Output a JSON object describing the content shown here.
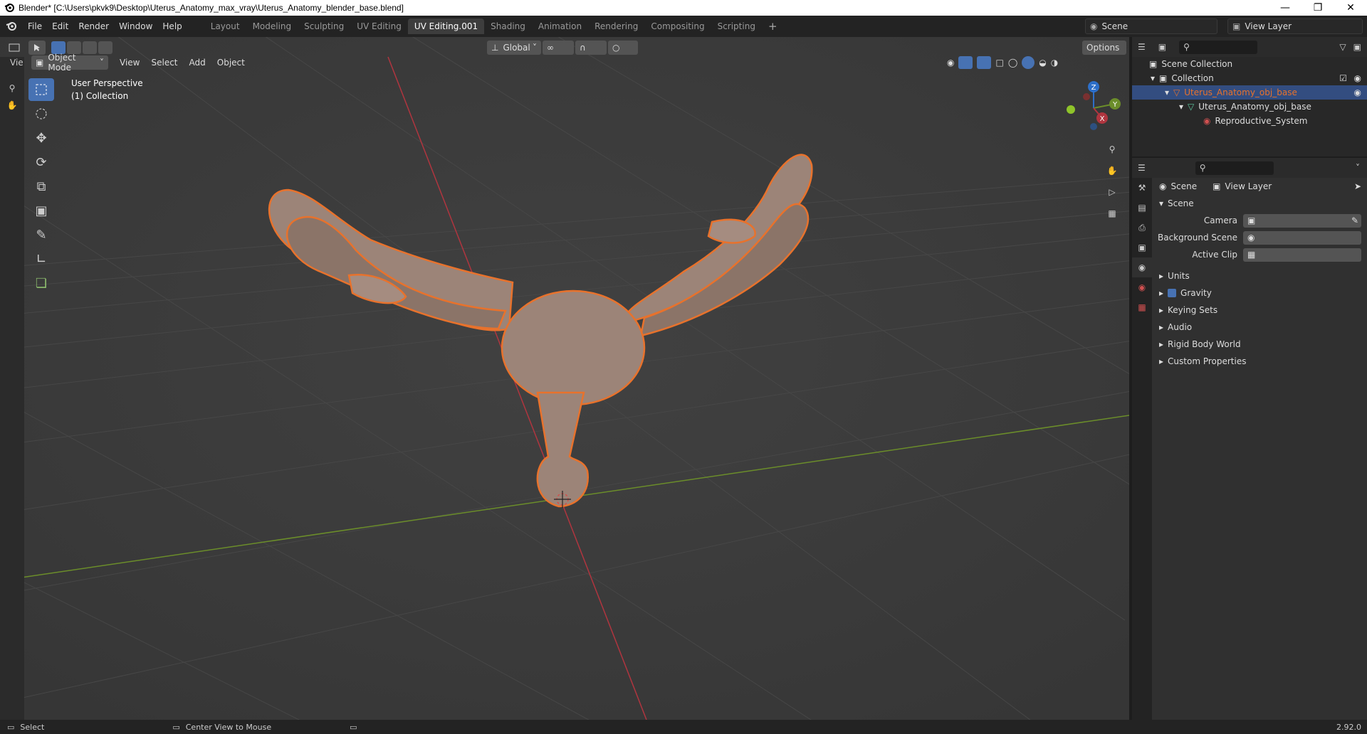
{
  "window": {
    "title": "Blender* [C:\\Users\\pkvk9\\Desktop\\Uterus_Anatomy_max_vray\\Uterus_Anatomy_blender_base.blend]"
  },
  "menu": [
    "File",
    "Edit",
    "Render",
    "Window",
    "Help"
  ],
  "workspaces": [
    "Layout",
    "Modeling",
    "Sculpting",
    "UV Editing",
    "UV Editing.001",
    "Shading",
    "Animation",
    "Rendering",
    "Compositing",
    "Scripting"
  ],
  "active_workspace": "UV Editing.001",
  "scene_name": "Scene",
  "view_layer_name": "View Layer",
  "viewport": {
    "mode": "Object Mode",
    "menus": [
      "View",
      "Select",
      "Add",
      "Object"
    ],
    "transform_orientation": "Global",
    "options_label": "Options",
    "perspective_label": "User Perspective",
    "collection_label": "(1) Collection",
    "short_label": "Vie"
  },
  "gizmo": {
    "z": "Z",
    "y": "Y",
    "x": "X"
  },
  "outliner": {
    "items": [
      {
        "label": "Scene Collection",
        "indent": 0
      },
      {
        "label": "Collection",
        "indent": 1
      },
      {
        "label": "Uterus_Anatomy_obj_base",
        "indent": 2,
        "selected": true
      },
      {
        "label": "Uterus_Anatomy_obj_base",
        "indent": 3
      },
      {
        "label": "Reproductive_System",
        "indent": 4
      }
    ]
  },
  "properties": {
    "breadcrumb_scene": "Scene",
    "breadcrumb_layer": "View Layer",
    "scene_panel": "Scene",
    "camera_label": "Camera",
    "background_scene_label": "Background Scene",
    "active_clip_label": "Active Clip",
    "panels": [
      "Units",
      "Gravity",
      "Keying Sets",
      "Audio",
      "Rigid Body World",
      "Custom Properties"
    ]
  },
  "status": {
    "select": "Select",
    "center": "Center View to Mouse",
    "version": "2.92.0"
  },
  "colors": {
    "accent": "#4772b3",
    "selection_outline": "#e8722c",
    "model": "#9c8478",
    "grid": "#3c3c3c",
    "x_axis": "#b0353f",
    "y_axis": "#6b8d2a"
  }
}
